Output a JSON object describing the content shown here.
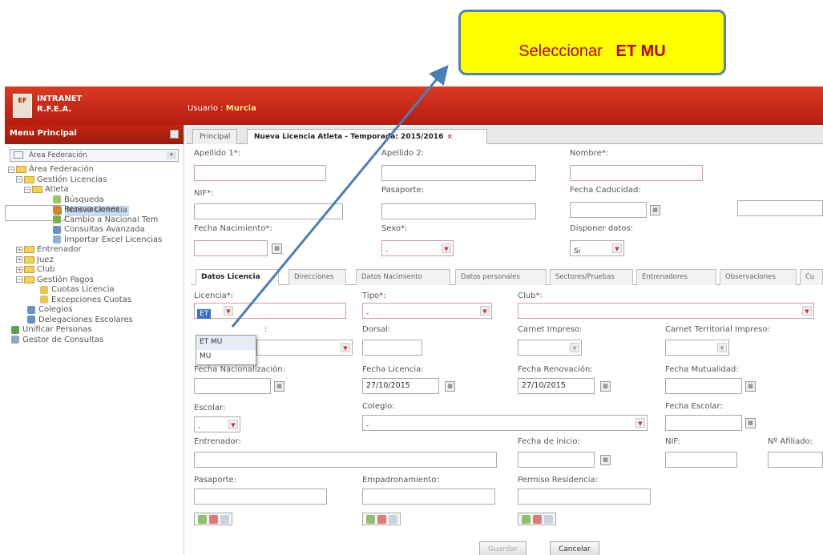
{
  "header": {
    "brand_line1": "INTRANET",
    "brand_line2": "R.F.E.A.",
    "logo_text": "EF",
    "user_label": "Usuario :",
    "user_name": "Murcia"
  },
  "sidebar": {
    "title": "Menu Principal",
    "area_selector": "Área Federación",
    "tree": [
      {
        "label": "Área Federación"
      },
      {
        "label": "Gestión Licencias"
      },
      {
        "label": "Atleta"
      },
      {
        "label": "Búsqueda"
      },
      {
        "label": "Nueva Licencia"
      },
      {
        "label": "Renovaciones"
      },
      {
        "label": "Cambio a Nacional Tem"
      },
      {
        "label": "Consultas Avanzada"
      },
      {
        "label": "Importar Excel Licencias"
      },
      {
        "label": "Entrenador"
      },
      {
        "label": "Juez"
      },
      {
        "label": "Club"
      },
      {
        "label": "Gestión Pagos"
      },
      {
        "label": "Cuotas Licencia"
      },
      {
        "label": "Excepciones Cuotas"
      },
      {
        "label": "Colegios"
      },
      {
        "label": "Delegaciones Escolares"
      },
      {
        "label": "Unificar Personas"
      },
      {
        "label": "Gestor de Consultas"
      }
    ]
  },
  "tabs": {
    "principal": "Principal",
    "active": "Nueva Licencia Atleta - Temporada: 2015/2016",
    "close": "×"
  },
  "form": {
    "apellido1": "Apellido 1*:",
    "apellido2": "Apellido 2:",
    "nombre": "Nombre*:",
    "nif": "NIF*:",
    "pasaporte": "Pasaporte:",
    "fecha_caducidad": "Fecha Caducidad:",
    "fecha_nacimiento": "Fecha Nacimiento*:",
    "sexo": "Sexo*:",
    "sexo_value": "-",
    "disponer_datos": "Disponer datos:",
    "disponer_value": "Si"
  },
  "inner_tabs": [
    "Datos Licencia",
    "Direcciones",
    "Datos Nacimiento",
    "Datos personales",
    "Sectores/Pruebas",
    "Entrenadores",
    "Observaciones",
    "Cu"
  ],
  "licencia": {
    "licencia_label": "Licencia*:",
    "licencia_value": "ET",
    "tipo_label": "Tipo*:",
    "tipo_value": "-",
    "club_label": "Club*:",
    "dropdown_options": [
      "ET MU",
      "MU"
    ],
    "categoria_fragment": ":",
    "dorsal": "Dorsal:",
    "carnet_impreso": "Carnet Impreso:",
    "carnet_territorial": "Carnet Territorial Impreso:",
    "fecha_nacionalizacion": "Fecha Nacionalización:",
    "fecha_licencia": "Fecha Licencia:",
    "fecha_licencia_value": "27/10/2015",
    "fecha_renovacion": "Fecha Renovación:",
    "fecha_renovacion_value": "27/10/2015",
    "fecha_mutualidad": "Fecha Mutualidad:",
    "escolar": "Escolar:",
    "escolar_value": "-",
    "colegio": "Colegio:",
    "colegio_value": "-",
    "fecha_escolar": "Fecha Escolar:",
    "entrenador": "Entrenador:",
    "fecha_inicio": "Fecha de inicio:",
    "nif2": "NIF:",
    "n_afiliado": "Nº Afiliado:",
    "pasaporte2": "Pasaporte:",
    "empadronamiento": "Empadronamiento:",
    "permiso_residencia": "Permiso Residencia:"
  },
  "buttons": {
    "guardar": "Guardar",
    "cancelar": "Cancelar"
  },
  "callout": {
    "prefix": "Seleccionar",
    "bold": "ET MU"
  },
  "colors": {
    "header_red": "#c4220f",
    "callout_yellow": "#ffff00",
    "callout_border": "#4f81bd",
    "callout_text": "#c00000",
    "arrow": "#4a7ebb"
  }
}
